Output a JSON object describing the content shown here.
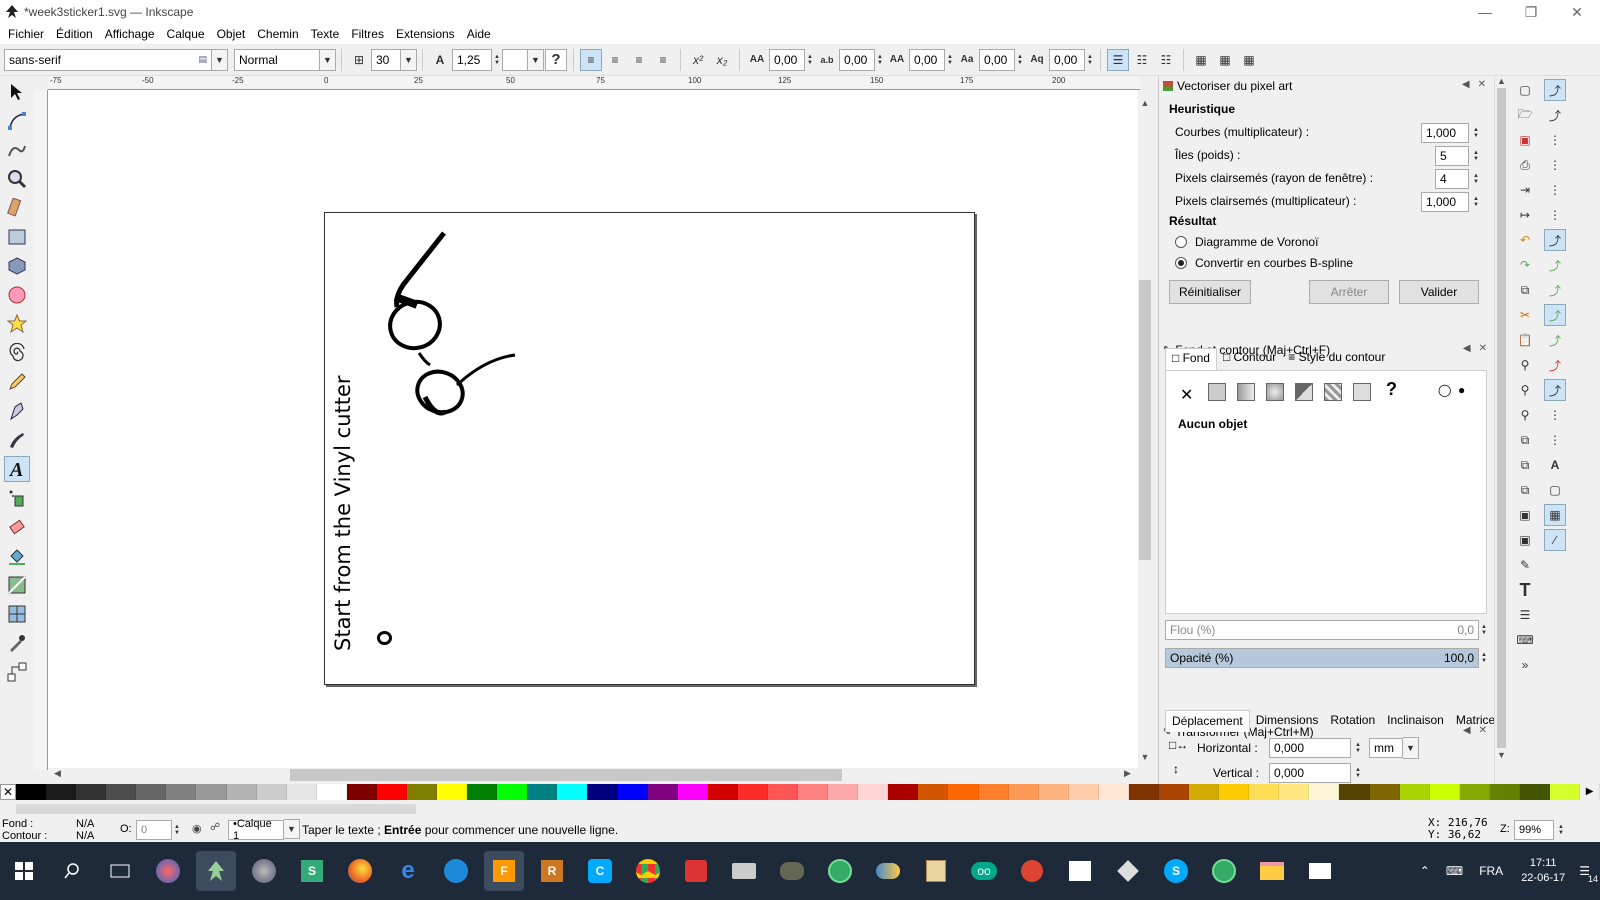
{
  "window": {
    "title": "*week3sticker1.svg — Inkscape"
  },
  "menu": [
    "Fichier",
    "Édition",
    "Affichage",
    "Calque",
    "Objet",
    "Chemin",
    "Texte",
    "Filtres",
    "Extensions",
    "Aide"
  ],
  "text_toolbar": {
    "font_family": "sans-serif",
    "font_style": "Normal",
    "font_size": "30",
    "line_spacing": "1,25",
    "help_glyph": "?",
    "letter_spacing": "0,00",
    "word_spacing": "0,00",
    "kerning": "0,00",
    "vertical_shift": "0,00",
    "rotation": "0,00"
  },
  "ruler_labels": [
    "-75",
    "-50",
    "-25",
    "0",
    "25",
    "50",
    "75",
    "100",
    "125",
    "150",
    "175",
    "200"
  ],
  "canvas": {
    "rotated_text": "Start from the Vinyl cutter"
  },
  "vectorize_panel": {
    "title": "Vectoriser du pixel art",
    "section_heuristique": "Heuristique",
    "rows": [
      {
        "label": "Courbes (multiplicateur) :",
        "value": "1,000"
      },
      {
        "label": "Îles (poids) :",
        "value": "5"
      },
      {
        "label": "Pixels clairsemés (rayon de fenêtre) :",
        "value": "4"
      },
      {
        "label": "Pixels clairsemés (multiplicateur) :",
        "value": "1,000"
      }
    ],
    "section_resultat": "Résultat",
    "radio_voronoi": "Diagramme de Voronoï",
    "radio_bspline": "Convertir en courbes B-spline",
    "btn_reset": "Réinitialiser",
    "btn_stop": "Arrêter",
    "btn_ok": "Valider"
  },
  "fill_panel": {
    "title": "Fond et contour (Maj+Ctrl+F)",
    "tabs": [
      "Fond",
      "Contour",
      "Style du contour"
    ],
    "no_object": "Aucun objet",
    "blur_label": "Flou (%)",
    "blur_value": "0,0",
    "opacity_label": "Opacité (%)",
    "opacity_value": "100,0",
    "opacity_fraction": 1.0
  },
  "transform_panel": {
    "title": "Transformer (Maj+Ctrl+M)",
    "tabs": [
      "Déplacement",
      "Dimensions",
      "Rotation",
      "Inclinaison",
      "Matrice"
    ],
    "horizontal_label": "Horizontal :",
    "horizontal_value": "0,000",
    "vertical_label": "Vertical :",
    "vertical_value": "0,000",
    "unit": "mm"
  },
  "palette_colors": [
    "#000000",
    "#1a1a1a",
    "#333333",
    "#4d4d4d",
    "#666666",
    "#808080",
    "#999999",
    "#b3b3b3",
    "#cccccc",
    "#e6e6e6",
    "#ffffff",
    "#800000",
    "#ff0000",
    "#808000",
    "#ffff00",
    "#008000",
    "#00ff00",
    "#008080",
    "#00ffff",
    "#000080",
    "#0000ff",
    "#800080",
    "#ff00ff",
    "#d40000",
    "#ff2a2a",
    "#ff5555",
    "#ff8080",
    "#ffaaaa",
    "#ffd5d5",
    "#aa0000",
    "#d45500",
    "#ff6600",
    "#ff7f2a",
    "#ff9955",
    "#ffb380",
    "#ffccaa",
    "#ffe6d5",
    "#803300",
    "#aa4400",
    "#d4aa00",
    "#ffcc00",
    "#ffdd55",
    "#ffe680",
    "#fff6d5",
    "#554400",
    "#806600",
    "#aad400",
    "#ccff00",
    "#88aa00",
    "#668000",
    "#445500",
    "#d4ff2a"
  ],
  "statusbar": {
    "fill_label": "Fond :",
    "fill_value": "N/A",
    "stroke_label": "Contour :",
    "stroke_value": "N/A",
    "opacity_label": "O:",
    "opacity_value": "0",
    "layer": "•Calque 1",
    "message_pre": "Taper le texte ; ",
    "message_bold": "Entrée",
    "message_post": " pour commencer une nouvelle ligne.",
    "x_label": "X:",
    "x_value": "216,76",
    "y_label": "Y:",
    "y_value": "36,62",
    "zoom_label": "Z:",
    "zoom_value": "99%"
  },
  "taskbar": {
    "language": "FRA",
    "time": "17:11",
    "date": "22-06-17",
    "notifications": "14"
  }
}
